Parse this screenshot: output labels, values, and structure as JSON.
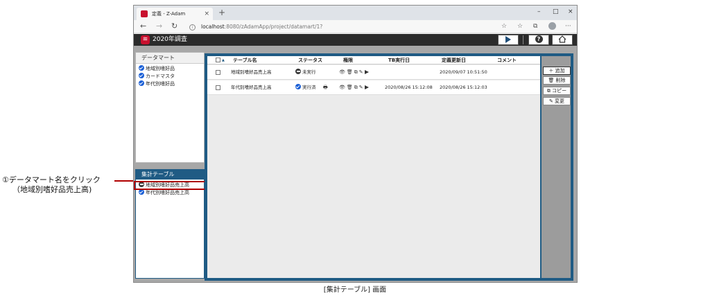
{
  "browser": {
    "tab_title": "定義 - Z-Adam",
    "tab_close": "×",
    "new_tab": "+",
    "url_host": "localhost",
    "url_path": ":8080/zAdamApp/project/datamart/1?",
    "win_minimize": "–",
    "win_maximize": "□",
    "win_close": "×",
    "nav_back": "←",
    "nav_forward": "→",
    "nav_reload": "↻",
    "tool_star": "☆",
    "tool_favorites": "☆",
    "tool_collections": "⧉",
    "tool_more": "···"
  },
  "app": {
    "title": "2020年調査",
    "logo_glyph": "≋"
  },
  "datamart_panel": {
    "title": "データマート",
    "items": [
      "地域別嗜好品",
      "カードマスタ",
      "年代別嗜好品"
    ]
  },
  "summary_panel": {
    "title": "集計テーブル",
    "items": [
      {
        "label": "地域別嗜好品売上高",
        "status": "stop"
      },
      {
        "label": "年代別嗜好品売上高",
        "status": "check"
      }
    ]
  },
  "grid": {
    "sort_mark": "▲",
    "headers": {
      "name": "テーブル名",
      "status": "ステータス",
      "perm": "権限",
      "tb_exec": "TB実行日",
      "updated": "定義更新日",
      "comment": "コメント"
    },
    "ops": {
      "view": "👁",
      "delete": "🗑",
      "copy": "⧉",
      "edit": "✎"
    },
    "print_icon": "🖶",
    "rows": [
      {
        "name": "地域別嗜好品売上高",
        "status": "未実行",
        "status_kind": "stop",
        "tb_exec": "",
        "updated": "2020/09/07 10:51:50",
        "comment": ""
      },
      {
        "name": "年代別嗜好品売上高",
        "status": "実行済",
        "status_kind": "check",
        "tb_exec": "2020/08/26 15:12:08",
        "updated": "2020/08/26 15:12:03",
        "comment": ""
      }
    ]
  },
  "actions": {
    "add": "＋ 追加",
    "delete": "🗑 削除",
    "copy": "⧉ コピー",
    "edit": "✎ 変更"
  },
  "annotation": {
    "line1": "①データマート名をクリック",
    "line2": "（地域別嗜好品売上高)"
  },
  "caption": "[集計テーブル] 画面",
  "colors": {
    "accent": "#1f5b84",
    "highlight": "#b00000",
    "header": "#2b2b2b"
  }
}
